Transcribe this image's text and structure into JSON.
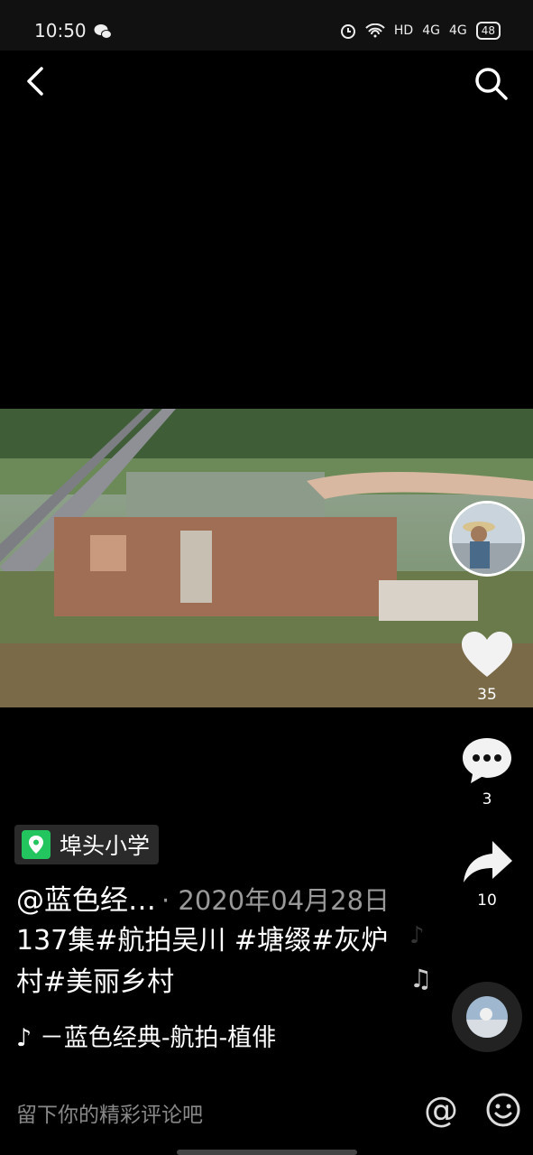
{
  "status": {
    "time": "10:50",
    "network": "HD",
    "sig1": "4G",
    "sig2": "4G",
    "battery": "48"
  },
  "location": {
    "label": "埠头小学"
  },
  "post": {
    "author": "@蓝色经…",
    "date": "· 2020年04月28日",
    "caption": "137集#航拍吴川 #塘缀#灰炉村#美丽乡村",
    "music": "♪ －蓝色经典-航拍-植俳"
  },
  "actions": {
    "likes": "35",
    "comments": "3",
    "shares": "10"
  },
  "comment": {
    "placeholder": "留下你的精彩评论吧",
    "at": "@"
  },
  "icons": [
    "back-icon",
    "search-icon",
    "heart-icon",
    "comment-icon",
    "share-icon",
    "location-pin-icon",
    "music-note-icon",
    "emoji-icon"
  ]
}
